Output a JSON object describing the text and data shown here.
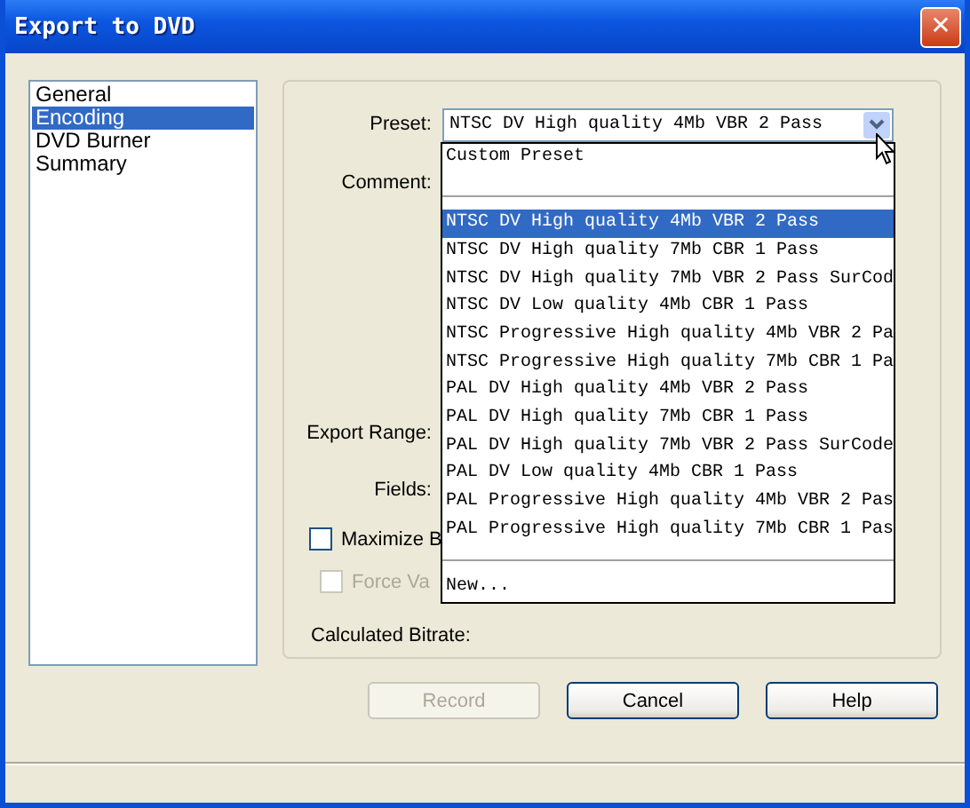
{
  "window": {
    "title": "Export to DVD",
    "close": "✕"
  },
  "sidebar": {
    "items": [
      {
        "label": "General",
        "selected": false
      },
      {
        "label": "Encoding",
        "selected": true
      },
      {
        "label": "DVD Burner",
        "selected": false
      },
      {
        "label": "Summary",
        "selected": false
      }
    ]
  },
  "form": {
    "preset_label": "Preset:",
    "preset_value": "NTSC DV High quality 4Mb VBR 2 Pass",
    "comment_label": "Comment:",
    "export_range_label": "Export Range:",
    "fields_label": "Fields:",
    "checkboxes": [
      {
        "label": "Maximize B",
        "checked": false,
        "disabled": false
      },
      {
        "label": "Force Va",
        "checked": false,
        "disabled": true
      }
    ],
    "calculated_bitrate_label": "Calculated Bitrate:"
  },
  "dropdown": {
    "top_items": [
      "Custom Preset"
    ],
    "items": [
      {
        "label": "NTSC DV High quality 4Mb VBR 2 Pass",
        "selected": true
      },
      {
        "label": "NTSC DV High quality 7Mb CBR 1 Pass",
        "selected": false
      },
      {
        "label": "NTSC DV High quality 7Mb VBR 2 Pass SurCod",
        "selected": false
      },
      {
        "label": "NTSC DV Low quality 4Mb CBR 1 Pass",
        "selected": false
      },
      {
        "label": "NTSC Progressive High quality 4Mb VBR 2 Pa",
        "selected": false
      },
      {
        "label": "NTSC Progressive High quality 7Mb CBR 1 Pa",
        "selected": false
      },
      {
        "label": "PAL DV High quality 4Mb VBR 2 Pass",
        "selected": false
      },
      {
        "label": "PAL DV High quality 7Mb CBR 1 Pass",
        "selected": false
      },
      {
        "label": "PAL DV High quality 7Mb VBR 2 Pass SurCode",
        "selected": false
      },
      {
        "label": "PAL DV Low quality 4Mb CBR 1 Pass",
        "selected": false
      },
      {
        "label": "PAL Progressive High quality 4Mb VBR 2 Pas",
        "selected": false
      },
      {
        "label": "PAL Progressive High quality 7Mb CBR 1 Pas",
        "selected": false
      }
    ],
    "footer": "New..."
  },
  "buttons": [
    {
      "label": "Record",
      "disabled": true
    },
    {
      "label": "Cancel",
      "disabled": false
    },
    {
      "label": "Help",
      "disabled": false
    }
  ]
}
